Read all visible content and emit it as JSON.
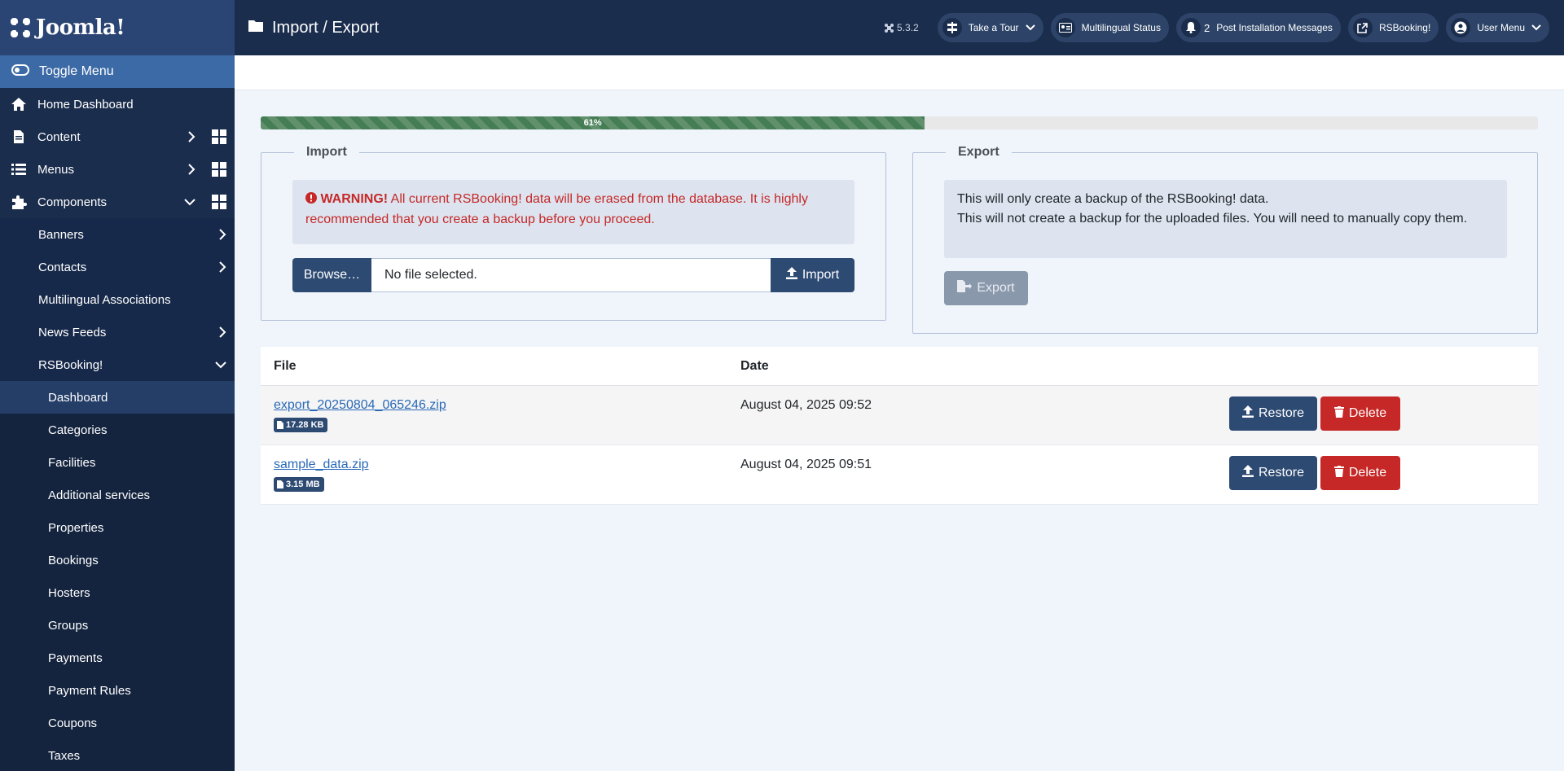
{
  "brand": {
    "logo_text": "Joomla!"
  },
  "sidebar": {
    "toggle_label": "Toggle Menu",
    "items": [
      {
        "label": "Home Dashboard"
      },
      {
        "label": "Content"
      },
      {
        "label": "Menus"
      },
      {
        "label": "Components"
      }
    ],
    "components_sub": [
      {
        "label": "Banners"
      },
      {
        "label": "Contacts"
      },
      {
        "label": "Multilingual Associations"
      },
      {
        "label": "News Feeds"
      },
      {
        "label": "RSBooking!"
      }
    ],
    "rsbooking_sub": [
      {
        "label": "Dashboard"
      },
      {
        "label": "Categories"
      },
      {
        "label": "Facilities"
      },
      {
        "label": "Additional services"
      },
      {
        "label": "Properties"
      },
      {
        "label": "Bookings"
      },
      {
        "label": "Hosters"
      },
      {
        "label": "Groups"
      },
      {
        "label": "Payments"
      },
      {
        "label": "Payment Rules"
      },
      {
        "label": "Coupons"
      },
      {
        "label": "Taxes"
      }
    ]
  },
  "header": {
    "title": "Import / Export",
    "version": "5.3.2",
    "take_tour": "Take a Tour",
    "multilingual_status": "Multilingual Status",
    "post_install_count": "2",
    "post_install": "Post Installation Messages",
    "rsbooking": "RSBooking!",
    "user_menu": "User Menu"
  },
  "progress": {
    "label": "61%",
    "value": 0.52
  },
  "import": {
    "legend": "Import",
    "warning_strong": "WARNING!",
    "warning_text": "All current RSBooking! data will be erased from the database. It is highly recommended that you create a backup before you proceed.",
    "browse_label": "Browse…",
    "file_placeholder": "No file selected.",
    "import_label": "Import"
  },
  "export": {
    "legend": "Export",
    "info_line1": "This will only create a backup of the RSBooking! data.",
    "info_line2": "This will not create a backup for the uploaded files. You will need to manually copy them.",
    "export_label": "Export"
  },
  "table": {
    "headers": {
      "file": "File",
      "date": "Date"
    },
    "rows": [
      {
        "file": "export_20250804_065246.zip",
        "size": "17.28 KB",
        "date": "August 04, 2025 09:52"
      },
      {
        "file": "sample_data.zip",
        "size": "3.15 MB",
        "date": "August 04, 2025 09:51"
      }
    ],
    "restore_label": "Restore",
    "delete_label": "Delete"
  },
  "colors": {
    "primary": "#2d4a73",
    "danger": "#c52827",
    "sidebar": "#1b2d4d",
    "progress": "#457d54"
  }
}
